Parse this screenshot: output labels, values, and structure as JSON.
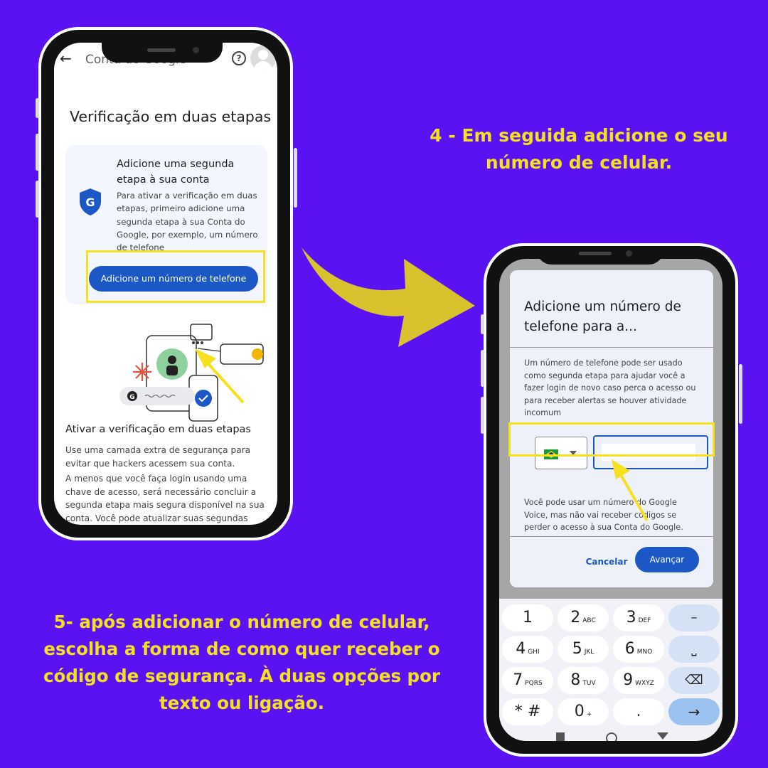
{
  "caption_step4": "4 - Em seguida adicione o seu número de celular.",
  "caption_step5": "5- após adicionar o número de celular, escolha a forma de como quer receber o código de segurança. À duas opções por texto ou ligação.",
  "left_phone": {
    "account_title": "Conta do Google",
    "page_title": "Verificação em duas etapas",
    "card_heading": "Adicione uma segunda etapa à sua conta",
    "card_text": "Para ativar a verificação em duas etapas, primeiro adicione uma segunda etapa à sua Conta do Google, por exemplo, um número de telefone",
    "add_phone_button": "Adicione um número de telefone",
    "illustration_text": "~~~~~~~~",
    "section_heading": "Ativar a verificação em duas etapas",
    "section_p1": "Use uma camada extra de segurança para evitar que hackers acessem sua conta.",
    "section_p2": "A menos que você faça login usando uma chave de acesso, será necessário concluir a segunda etapa mais segura disponível na sua conta. Você pode atualizar suas segundas etapas e opções de login nas configurações quando quiser."
  },
  "right_phone": {
    "dialog_title": "Adicione um número de telefone para a...",
    "dialog_description": "Um número de telefone pode ser usado como segunda etapa para ajudar você a fazer login de novo caso perca o acesso ou para receber alertas se houver atividade incomum",
    "phone_input_value": "",
    "dialog_note": "Você pode usar um número do Google Voice, mas não vai receber códigos se perder o acesso à sua Conta do Google. Pode haver cobranças da sua operadora.",
    "cancel_button": "Cancelar",
    "next_button": "Avançar",
    "keypad": [
      {
        "main": "1",
        "sub": ""
      },
      {
        "main": "2",
        "sub": "ABC"
      },
      {
        "main": "3",
        "sub": "DEF"
      },
      {
        "main": "–",
        "sub": ""
      },
      {
        "main": "4",
        "sub": "GHI"
      },
      {
        "main": "5",
        "sub": "JKL"
      },
      {
        "main": "6",
        "sub": "MNO"
      },
      {
        "main": "⎵",
        "sub": ""
      },
      {
        "main": "7",
        "sub": "PQRS"
      },
      {
        "main": "8",
        "sub": "TUV"
      },
      {
        "main": "9",
        "sub": "WXYZ"
      },
      {
        "main": "⌫",
        "sub": ""
      },
      {
        "main": "* #",
        "sub": ""
      },
      {
        "main": "0",
        "sub": "+"
      },
      {
        "main": ".",
        "sub": ""
      },
      {
        "main": "→",
        "sub": ""
      }
    ]
  },
  "colors": {
    "background": "#5a12f2",
    "caption": "#f5e11f",
    "highlight": "#f5e11f",
    "google_blue": "#1c57c6",
    "arrow": "#d9c22e"
  }
}
